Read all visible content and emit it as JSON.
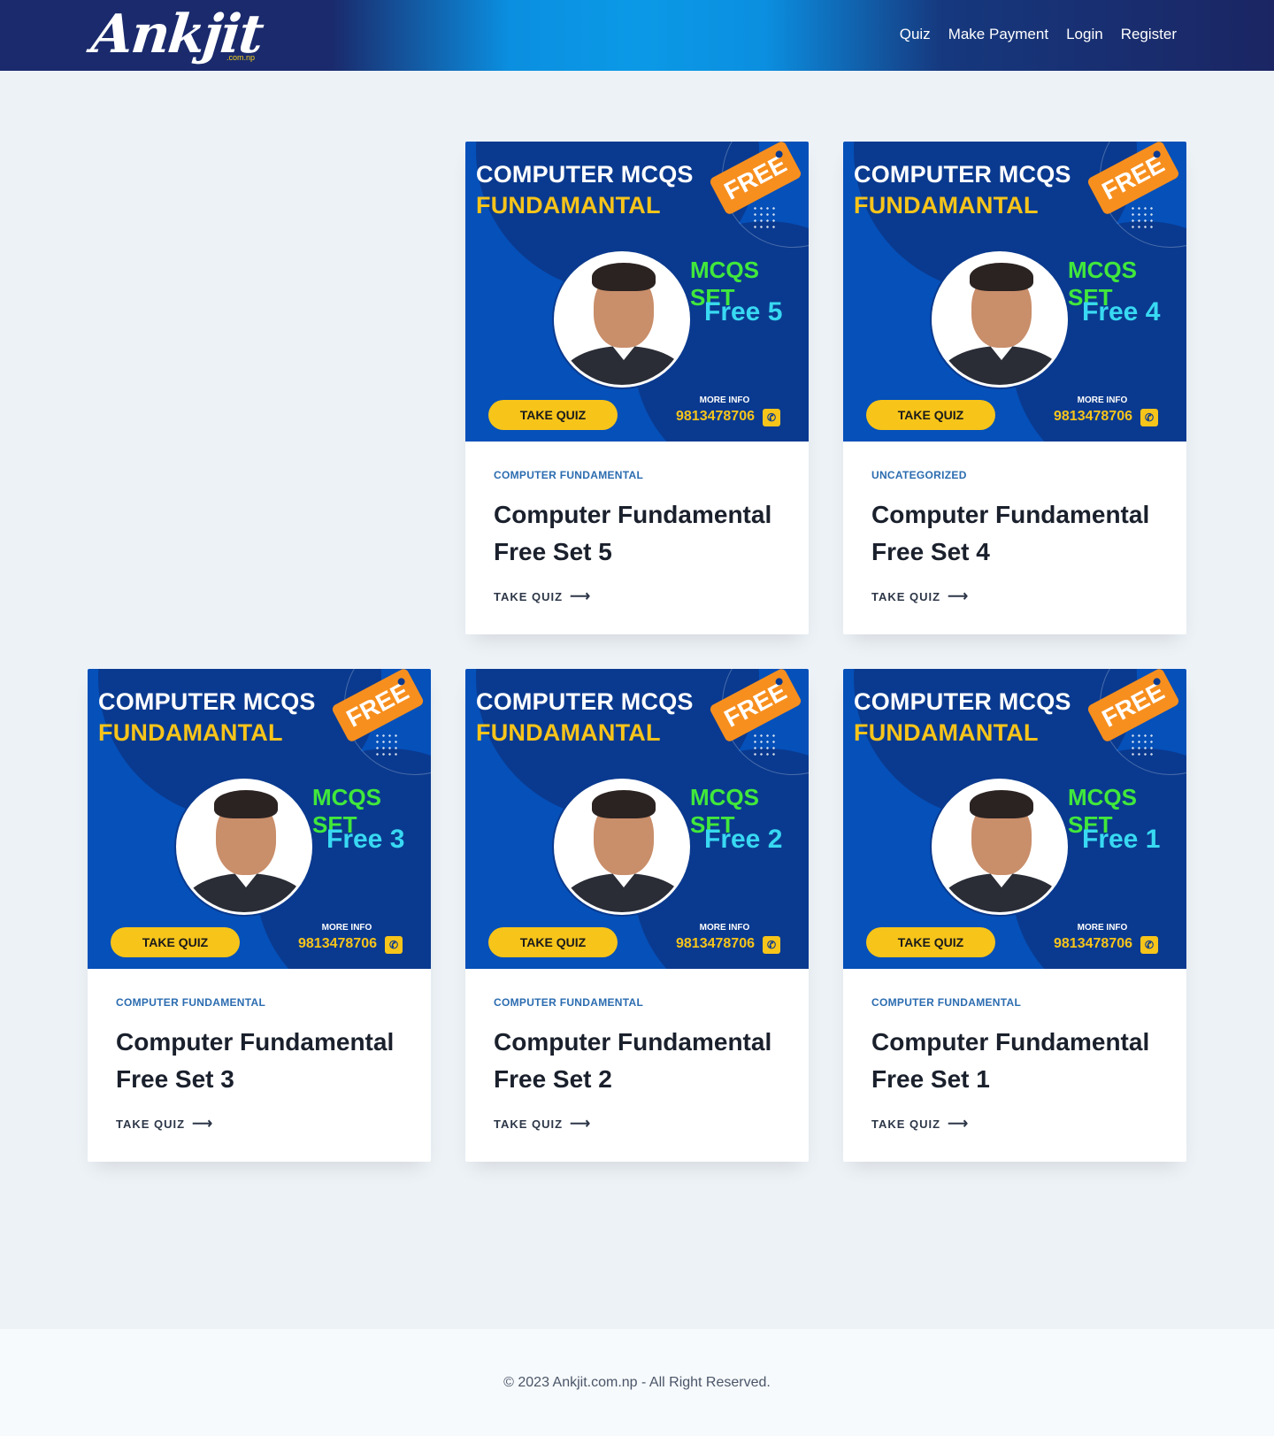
{
  "header": {
    "logo_text": "Ankjit",
    "logo_sub": ".com.np",
    "nav": [
      "Quiz",
      "Make Payment",
      "Login",
      "Register"
    ]
  },
  "image_text": {
    "line1": "COMPUTER MCQS",
    "line2": "FUNDAMANTAL",
    "tag": "FREE",
    "mcqs_set": "MCQS SET",
    "button": "TAKE QUIZ",
    "more_info": "MORE INFO",
    "phone": "9813478706"
  },
  "posts": [
    {
      "category": "COMPUTER FUNDAMENTAL",
      "title": "Computer Fundamental Free Set 5",
      "free_label": "Free 5",
      "cta": "TAKE QUIZ"
    },
    {
      "category": "UNCATEGORIZED",
      "title": "Computer Fundamental Free Set 4",
      "free_label": "Free 4",
      "cta": "TAKE QUIZ"
    },
    {
      "category": "COMPUTER FUNDAMENTAL",
      "title": "Computer Fundamental Free Set 3",
      "free_label": "Free 3",
      "cta": "TAKE QUIZ"
    },
    {
      "category": "COMPUTER FUNDAMENTAL",
      "title": "Computer Fundamental Free Set 2",
      "free_label": "Free 2",
      "cta": "TAKE QUIZ"
    },
    {
      "category": "COMPUTER FUNDAMENTAL",
      "title": "Computer Fundamental Free Set 1",
      "free_label": "Free 1",
      "cta": "TAKE QUIZ"
    }
  ],
  "icons": {
    "cta_arrow": "long-arrow-right-icon",
    "phone": "phone-icon"
  },
  "colors": {
    "header_dark": "#1a2a6c",
    "header_light": "#0b99e6",
    "category": "#2b6cb0",
    "image_bg": "#0550b9",
    "accent_yellow": "#f7c41a",
    "tag_orange": "#f78f1e"
  },
  "footer": {
    "copyright": "© 2023 Ankjit.com.np - All Right Reserved."
  }
}
